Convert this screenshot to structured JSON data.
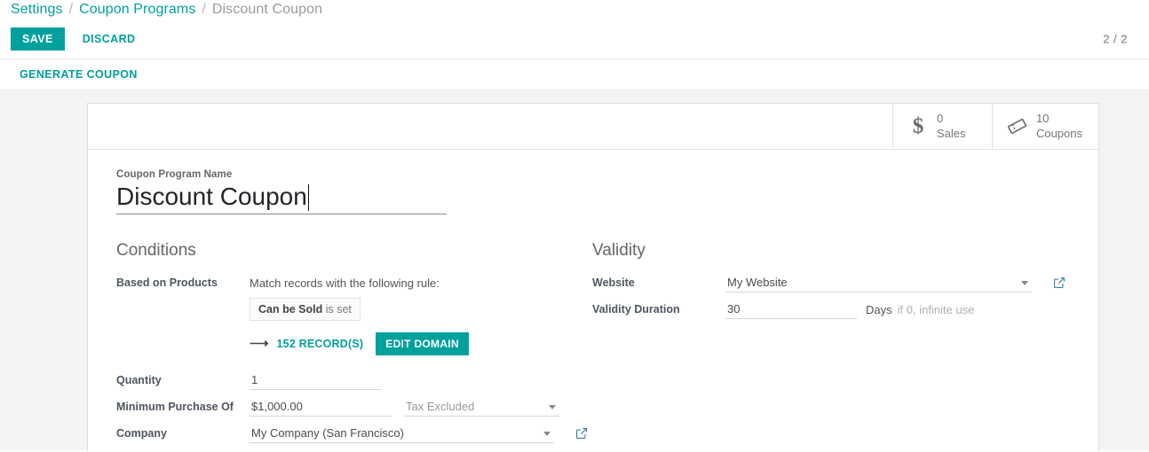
{
  "breadcrumb": {
    "items": [
      {
        "label": "Settings",
        "active": false
      },
      {
        "label": "Coupon Programs",
        "active": false
      },
      {
        "label": "Discount Coupon",
        "active": true
      }
    ],
    "separator": "/"
  },
  "control_panel": {
    "save_label": "SAVE",
    "discard_label": "DISCARD",
    "pager": "2 / 2"
  },
  "statusbar": {
    "generate_coupon_label": "GENERATE COUPON"
  },
  "stat_buttons": [
    {
      "icon": "dollar-icon",
      "value": "0",
      "label": "Sales"
    },
    {
      "icon": "ticket-icon",
      "value": "10",
      "label": "Coupons"
    }
  ],
  "title_field": {
    "label": "Coupon Program Name",
    "value": "Discount Coupon"
  },
  "conditions": {
    "title": "Conditions",
    "based_on_products": {
      "label": "Based on Products",
      "rule_intro": "Match records with the following rule:",
      "chip_field": "Can be Sold",
      "chip_operator": "is set",
      "arrow_icon": "arrow-right-icon",
      "records_link": "152 RECORD(S)",
      "edit_domain_label": "EDIT DOMAIN"
    },
    "quantity": {
      "label": "Quantity",
      "value": "1"
    },
    "minimum_purchase": {
      "label": "Minimum Purchase Of",
      "value": "$1,000.00",
      "tax_mode": "Tax Excluded"
    },
    "company": {
      "label": "Company",
      "value": "My Company (San Francisco)",
      "external_link_icon": "external-link-icon"
    }
  },
  "validity": {
    "title": "Validity",
    "website": {
      "label": "Website",
      "value": "My Website",
      "external_link_icon": "external-link-icon"
    },
    "validity_duration": {
      "label": "Validity Duration",
      "value": "30",
      "unit": "Days",
      "help": "if 0, infinite use"
    }
  },
  "colors": {
    "accent": "#00a09d",
    "muted": "#9b9b9b",
    "background": "#f4f4f4"
  }
}
